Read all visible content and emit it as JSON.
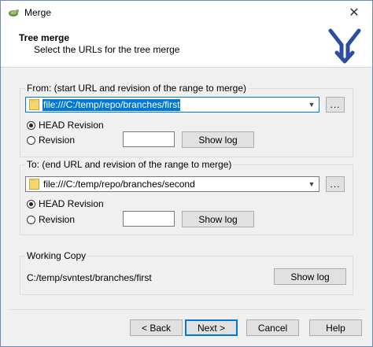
{
  "window": {
    "title": "Merge",
    "close_glyph": "✕"
  },
  "header": {
    "title": "Tree merge",
    "subtitle": "Select the URLs for the tree merge",
    "icon": "merge-arrow-icon",
    "icon_color": "#2b4ea3"
  },
  "from": {
    "group_label": "From: (start URL and revision of the range to merge)",
    "url": "file:///C:/temp/repo/branches/first",
    "browse_label": "...",
    "head_revision_label": "HEAD Revision",
    "revision_label": "Revision",
    "revision_value": "",
    "show_log_label": "Show log",
    "selected_option": "HEAD Revision"
  },
  "to": {
    "group_label": "To: (end URL and revision of the range to merge)",
    "url": "file:///C:/temp/repo/branches/second",
    "browse_label": "...",
    "head_revision_label": "HEAD Revision",
    "revision_label": "Revision",
    "revision_value": "",
    "show_log_label": "Show log",
    "selected_option": "HEAD Revision"
  },
  "working_copy": {
    "group_label": "Working Copy",
    "path": "C:/temp/svntest/branches/first",
    "show_log_label": "Show log"
  },
  "footer": {
    "back_label": "< Back",
    "next_label": "Next >",
    "cancel_label": "Cancel",
    "help_label": "Help"
  },
  "colors": {
    "accent": "#0078d7",
    "folder": "#f5d76e"
  }
}
